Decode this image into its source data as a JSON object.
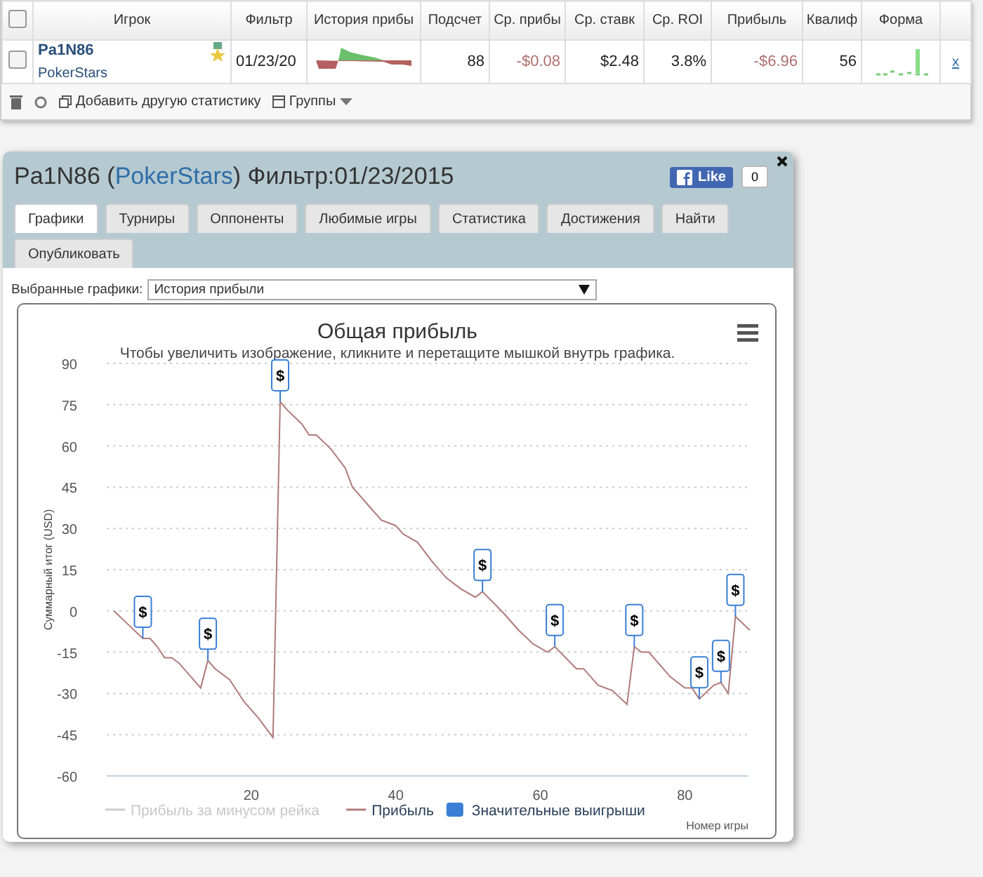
{
  "table": {
    "columns": [
      "Игрок",
      "Фильтр",
      "История прибы",
      "Подсчет",
      "Ср. прибы",
      "Ср. ставк",
      "Ср. ROI",
      "Прибыль",
      "Квалиф",
      "Форма"
    ],
    "rows": [
      {
        "checked": false,
        "player": "Pa1N86",
        "site": "PokerStars",
        "filter": "01/23/20",
        "count": "88",
        "avg_profit": "-$0.08",
        "avg_stake": "$2.48",
        "roi": "3.8%",
        "profit": "-$6.96",
        "qualif": "56",
        "remove": "x"
      }
    ],
    "header_checked": false,
    "toolbar": {
      "add_stat": "Добавить другую статистику",
      "groups": "Группы"
    }
  },
  "dialog": {
    "title_before": "Pa1N86 (",
    "site": "PokerStars",
    "title_after": ") Фильтр:01/23/2015",
    "like": "Like",
    "like_count": "0",
    "tabs": [
      {
        "label": "Графики",
        "selected": true
      },
      {
        "label": "Турниры",
        "selected": false
      },
      {
        "label": "Оппоненты",
        "selected": false
      },
      {
        "label": "Любимые игры",
        "selected": false
      },
      {
        "label": "Статистика",
        "selected": false
      },
      {
        "label": "Достижения",
        "selected": false
      },
      {
        "label": "Найти",
        "selected": false
      },
      {
        "label": "Опубликовать",
        "selected": false
      }
    ],
    "chart_select": {
      "label": "Выбранные графики:",
      "value": "История прибыли"
    },
    "chart": {
      "subtitle": "Чтобы увеличить изображение, кликните и перетащите мышкой внутрь графика.",
      "hidden_series": {
        "name": "Прибыль за минусом рейка"
      },
      "flags_legend": {
        "name": "Значительные выигрыши",
        "color": "#3a7fd5"
      },
      "chart_data": {
        "type": "line",
        "title": "Общая прибыль",
        "xlabel": "Номер игры",
        "ylabel": "Суммарный итог (USD)",
        "x": [
          1,
          3,
          5,
          6,
          7,
          8,
          9,
          10,
          12,
          13,
          14,
          15,
          17,
          19,
          21,
          23,
          24,
          25,
          27,
          28,
          29,
          31,
          33,
          34,
          36,
          38,
          40,
          41,
          43,
          45,
          47,
          49,
          51,
          52,
          55,
          57,
          59,
          61,
          62,
          65,
          66,
          68,
          70,
          72,
          73,
          74,
          75,
          78,
          80,
          81,
          82,
          84,
          85,
          86,
          87,
          89
        ],
        "series": [
          {
            "name": "Прибыль",
            "color": "#b07a7a",
            "values": [
              0,
              -5,
              -10,
              -10,
              -13,
              -17,
              -17,
              -19,
              -25,
              -28,
              -18,
              -21,
              -25,
              -33,
              -39,
              -46,
              76,
              73,
              68,
              64,
              64,
              59,
              52,
              45,
              39,
              33,
              31,
              28,
              25,
              18,
              12,
              8,
              5,
              7,
              -1,
              -7,
              -12,
              -15,
              -13,
              -21,
              -21,
              -27,
              -29,
              -34,
              -13,
              -15,
              -15,
              -24,
              -28,
              -28,
              -32,
              -27,
              -26,
              -30,
              -2,
              -7
            ]
          }
        ],
        "xlim": [
          0,
          89
        ],
        "ylim": [
          -60,
          90
        ],
        "xticks": [
          20,
          40,
          60,
          80
        ],
        "yticks": [
          90,
          75,
          60,
          45,
          30,
          15,
          0,
          -15,
          -30,
          -45,
          -60
        ],
        "grid": true,
        "annotations": [
          {
            "x": 5,
            "y": -10,
            "text": "$"
          },
          {
            "x": 14,
            "y": -18,
            "text": "$"
          },
          {
            "x": 24,
            "y": 76,
            "text": "$"
          },
          {
            "x": 52,
            "y": 7,
            "text": "$"
          },
          {
            "x": 62,
            "y": -13,
            "text": "$"
          },
          {
            "x": 73,
            "y": -13,
            "text": "$"
          },
          {
            "x": 82,
            "y": -32,
            "text": "$"
          },
          {
            "x": 85,
            "y": -26,
            "text": "$"
          },
          {
            "x": 87,
            "y": -2,
            "text": "$"
          }
        ]
      }
    }
  }
}
